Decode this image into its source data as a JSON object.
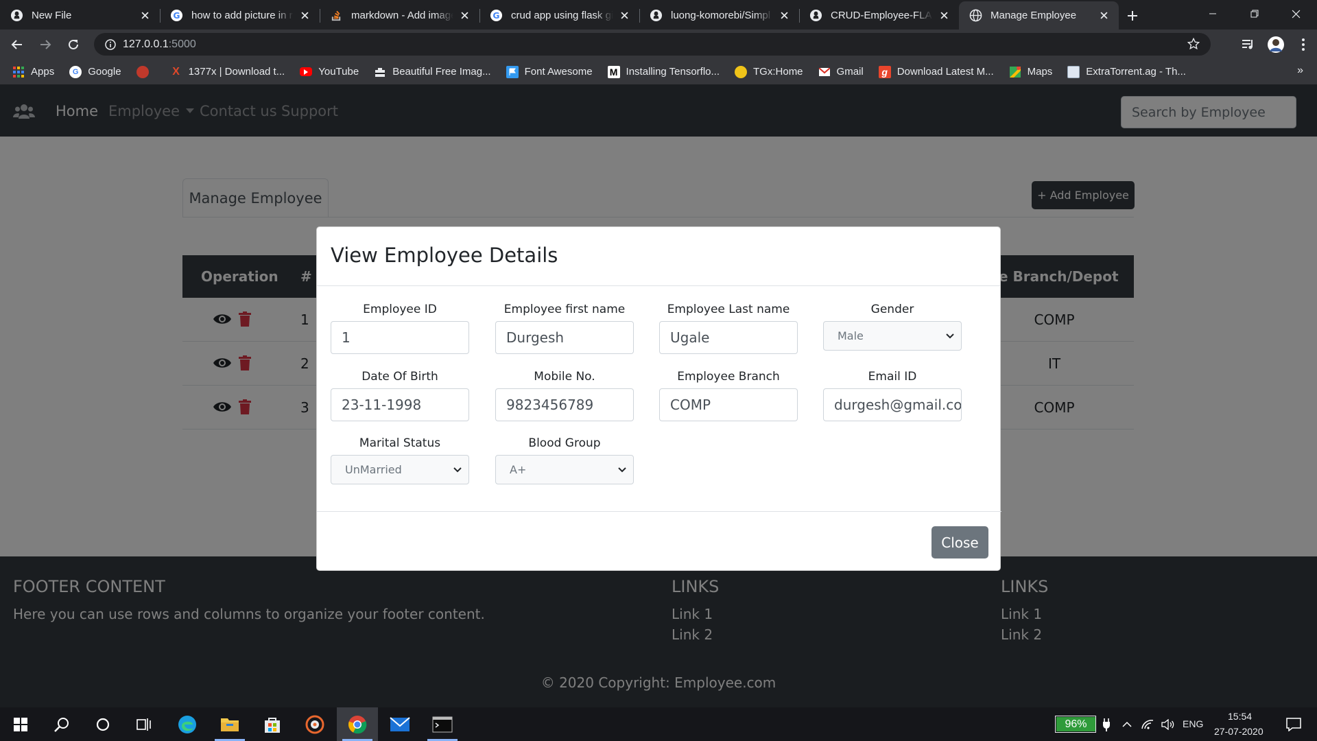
{
  "browser": {
    "tabs": [
      {
        "title": "New File",
        "icon": "github-icon",
        "active": false
      },
      {
        "title": "how to add picture in r",
        "icon": "google-icon",
        "active": false
      },
      {
        "title": "markdown - Add image",
        "icon": "stackoverflow-icon",
        "active": false
      },
      {
        "title": "crud app using flask gi",
        "icon": "google-icon",
        "active": false
      },
      {
        "title": "luong-komorebi/Simpl",
        "icon": "github-icon",
        "active": false
      },
      {
        "title": "CRUD-Employee-FLASK",
        "icon": "github-icon",
        "active": false
      },
      {
        "title": "Manage Employee",
        "icon": "globe-icon",
        "active": true
      }
    ],
    "url_host": "127.0.0.1",
    "url_port": ":5000",
    "bookmarks": [
      {
        "label": "Apps",
        "icon": "apps-grid-icon"
      },
      {
        "label": "Google",
        "icon": "google-icon"
      },
      {
        "label": "",
        "icon": "opera-icon"
      },
      {
        "label": "1377x | Download t...",
        "icon": "x-icon"
      },
      {
        "label": "YouTube",
        "icon": "youtube-icon"
      },
      {
        "label": "Beautiful Free Imag...",
        "icon": "camera-icon"
      },
      {
        "label": "Font Awesome",
        "icon": "flag-icon"
      },
      {
        "label": "Installing Tensorflo...",
        "icon": "medium-icon"
      },
      {
        "label": "TGx:Home",
        "icon": "tgx-icon"
      },
      {
        "label": "Gmail",
        "icon": "gmail-icon"
      },
      {
        "label": "Download Latest M...",
        "icon": "g-icon"
      },
      {
        "label": "Maps",
        "icon": "maps-icon"
      },
      {
        "label": "ExtraTorrent.ag - Th...",
        "icon": "page-icon"
      }
    ],
    "bookmarks_more": "»"
  },
  "app": {
    "nav": {
      "home": "Home",
      "employee": "Employee",
      "contact": "Contact us",
      "support": "Support",
      "search_placeholder": "Search by Employee"
    },
    "tab_label": "Manage Employee",
    "add_button": "+ Add Employee",
    "table": {
      "headers": {
        "operation": "Operation",
        "number": "#",
        "branch": "e Branch/Depot"
      },
      "rows": [
        {
          "num": "1",
          "branch": "COMP"
        },
        {
          "num": "2",
          "branch": "IT"
        },
        {
          "num": "3",
          "branch": "COMP"
        }
      ]
    },
    "footer": {
      "title": "FOOTER CONTENT",
      "text": "Here you can use rows and columns to organize your footer content.",
      "links_title_1": "LINKS",
      "links_title_2": "LINKS",
      "link1": "Link 1",
      "link2": "Link 2",
      "copyright": "© 2020 Copyright: Employee.com"
    }
  },
  "modal": {
    "title": "View Employee Details",
    "fields": {
      "employee_id": {
        "label": "Employee ID",
        "value": "1"
      },
      "first_name": {
        "label": "Employee first name",
        "value": "Durgesh"
      },
      "last_name": {
        "label": "Employee Last name",
        "value": "Ugale"
      },
      "gender": {
        "label": "Gender",
        "value": "Male"
      },
      "dob": {
        "label": "Date Of Birth",
        "value": "23-11-1998"
      },
      "mobile": {
        "label": "Mobile No.",
        "value": "9823456789"
      },
      "branch": {
        "label": "Employee Branch",
        "value": "COMP"
      },
      "email": {
        "label": "Email ID",
        "value": "durgesh@gmail.com"
      },
      "marital": {
        "label": "Marital Status",
        "value": "UnMarried"
      },
      "blood": {
        "label": "Blood Group",
        "value": "A+"
      }
    },
    "close_label": "Close"
  },
  "taskbar": {
    "battery": "96%",
    "language": "ENG",
    "time": "15:54",
    "date": "27-07-2020"
  },
  "colors": {
    "navbar": "#343a40",
    "danger": "#dc3545",
    "secondary": "#6c757d",
    "battery": "#2f9b3a"
  }
}
